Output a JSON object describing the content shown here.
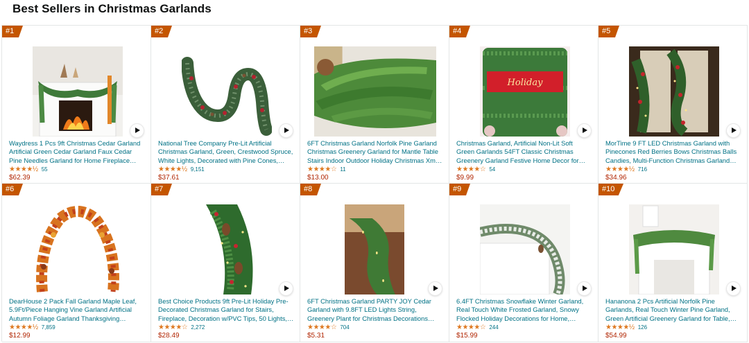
{
  "page": {
    "title": "Best Sellers in Christmas Garlands"
  },
  "products": [
    {
      "rank": "#1",
      "title": "Waydress 1 Pcs 9ft Christmas Cedar Garland Artificial Green Cedar Garland Faux Cedar Pine Needles Garland for Home Fireplace Indoor…",
      "stars": "★★★★½",
      "rating_value": 4.5,
      "reviews": "55",
      "price": "$62.39",
      "image": "fireplace-garland"
    },
    {
      "rank": "#2",
      "title": "National Tree Company Pre-Lit Artificial Christmas Garland, Green, Crestwood Spruce, White Lights, Decorated with Pine Cones, Ber…",
      "stars": "★★★★½",
      "rating_value": 4.5,
      "reviews": "9,151",
      "price": "$37.61",
      "image": "spruce-garland"
    },
    {
      "rank": "#3",
      "title": "6FT Christmas Garland Norfolk Pine Garland Christmas Greenery Garland for Mantle Table Stairs Indoor Outdoor Holiday Christmas Xm…",
      "stars": "★★★★☆",
      "rating_value": 4.0,
      "reviews": "11",
      "price": "$13.00",
      "image": "norfolk-pine"
    },
    {
      "rank": "#4",
      "title": "Christmas Garland, Artificial Non-Lit Soft Green Garlands 54FT Classic Christmas Greenery Garland Festive Home Decor for…",
      "stars": "★★★★☆",
      "rating_value": 4.0,
      "reviews": "54",
      "price": "$9.99",
      "image": "holiday-roll"
    },
    {
      "rank": "#5",
      "title": "MorTime 9 FT LED Christmas Garland with Pinecones Red Berries Bows Christmas Balls Candies, Multi-Function Christmas Garland…",
      "stars": "★★★★½",
      "rating_value": 4.5,
      "reviews": "716",
      "price": "$34.96",
      "image": "led-garland"
    },
    {
      "rank": "#6",
      "title": "DearHouse 2 Pack Fall Garland Maple Leaf, 5.9Ft/Piece Hanging Vine Garland Artificial Autumn Foliage Garland Thanksgiving Decor…",
      "stars": "★★★★½",
      "rating_value": 4.5,
      "reviews": "7,859",
      "price": "$12.99",
      "image": "maple-garland"
    },
    {
      "rank": "#7",
      "title": "Best Choice Products 9ft Pre-Lit Holiday Pre-Decorated Christmas Garland for Stairs, Fireplace, Decoration w/PVC Tips, 50 Lights,…",
      "stars": "★★★★☆",
      "rating_value": 4.0,
      "reviews": "2,272",
      "price": "$28.49",
      "image": "prelit-garland"
    },
    {
      "rank": "#8",
      "title": "6FT Christmas Garland PARTY JOY Cedar Garland with 9.8FT LED Lights String, Greenery Plant for Christmas Decorations Table Mantl…",
      "stars": "★★★★☆",
      "rating_value": 4.0,
      "reviews": "704",
      "price": "$5.31",
      "image": "cedar-led"
    },
    {
      "rank": "#9",
      "title": "6.4FT Christmas Snowflake Winter Garland, Real Touch White Frosted Garland, Snowy Flocked Holiday Decorations for Home,…",
      "stars": "★★★★☆",
      "rating_value": 4.0,
      "reviews": "244",
      "price": "$15.99",
      "image": "snowy-garland"
    },
    {
      "rank": "#10",
      "title": "Hananona 2 Pcs Artificial Norfolk Pine Garlands, Real Touch Winter Pine Garland, Green Artificial Greenery Garland for Table,…",
      "stars": "★★★★½",
      "rating_value": 4.5,
      "reviews": "126",
      "price": "$54.99",
      "image": "mantel-pine"
    }
  ]
}
